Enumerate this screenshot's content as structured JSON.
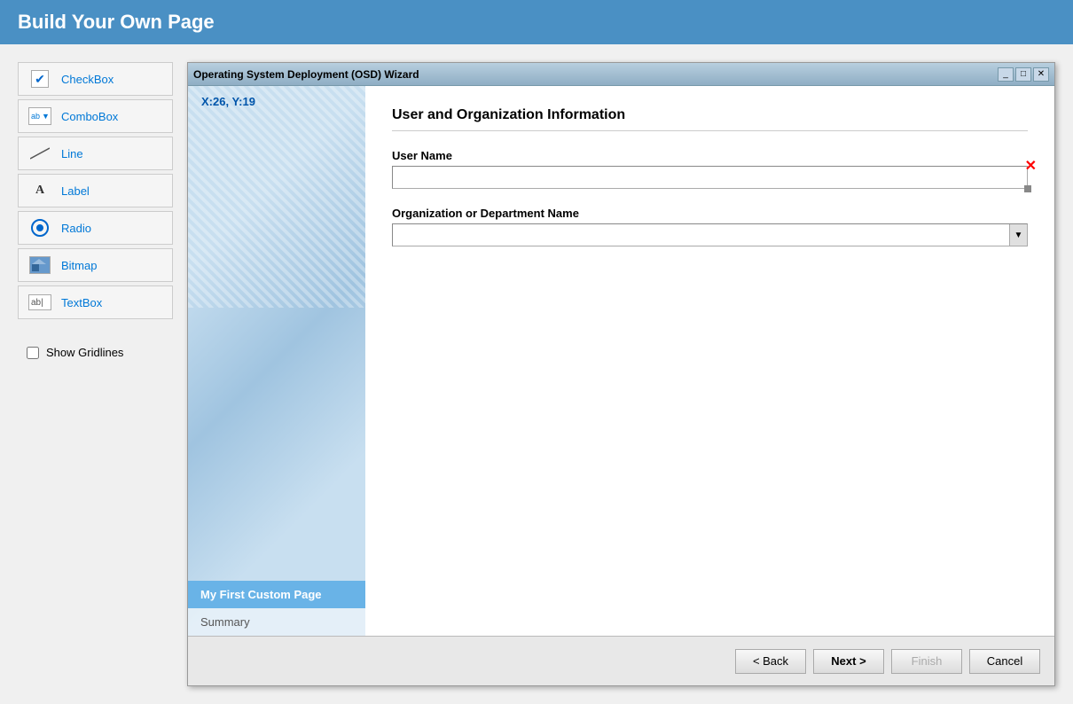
{
  "page": {
    "title": "Build Your Own Page"
  },
  "toolbox": {
    "items": [
      {
        "id": "checkbox",
        "label": "CheckBox",
        "icon": "checkbox-icon"
      },
      {
        "id": "combobox",
        "label": "ComboBox",
        "icon": "combobox-icon"
      },
      {
        "id": "line",
        "label": "Line",
        "icon": "line-icon"
      },
      {
        "id": "label",
        "label": "Label",
        "icon": "label-icon"
      },
      {
        "id": "radio",
        "label": "Radio",
        "icon": "radio-icon"
      },
      {
        "id": "bitmap",
        "label": "Bitmap",
        "icon": "bitmap-icon"
      },
      {
        "id": "textbox",
        "label": "TextBox",
        "icon": "textbox-icon"
      }
    ],
    "show_gridlines_label": "Show Gridlines"
  },
  "wizard": {
    "title": "Operating System Deployment (OSD) Wizard",
    "coords": "X:26, Y:19",
    "nav_items": [
      {
        "id": "custom-page",
        "label": "My First Custom Page",
        "active": true
      },
      {
        "id": "summary",
        "label": "Summary",
        "active": false
      }
    ],
    "content": {
      "title": "User and Organization Information",
      "fields": [
        {
          "id": "user-name",
          "label": "User Name",
          "type": "textbox",
          "value": ""
        },
        {
          "id": "org-name",
          "label": "Organization or Department Name",
          "type": "combobox",
          "value": ""
        }
      ]
    },
    "footer": {
      "back_label": "< Back",
      "next_label": "Next >",
      "finish_label": "Finish",
      "cancel_label": "Cancel"
    },
    "window_buttons": {
      "minimize": "_",
      "restore": "□",
      "close": "✕"
    }
  }
}
